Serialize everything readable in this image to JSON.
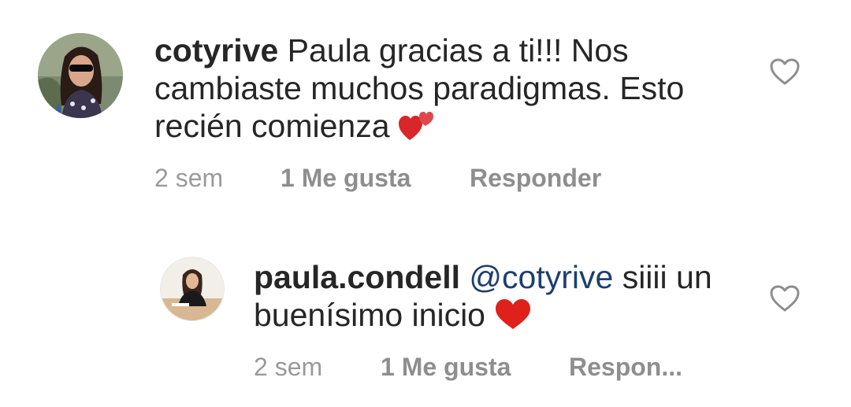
{
  "comments": [
    {
      "username": "cotyrive",
      "text_part1": "Paula gracias a ti!!! Nos cambiaste muchos paradigmas. Esto recién comienza",
      "emoji": "two-hearts",
      "time": "2 sem",
      "likes": "1 Me gusta",
      "reply": "Responder"
    },
    {
      "username": "paula.condell",
      "mention": "@cotyrive",
      "text_part1": "siiii un buenísimo inicio",
      "emoji": "red-heart",
      "time": "2 sem",
      "likes": "1 Me gusta",
      "reply": "Respon..."
    }
  ],
  "colors": {
    "text": "#262626",
    "meta": "#8e8e8e",
    "mention": "#1d3f6e",
    "heart_emoji": "#e0201b",
    "like_icon": "#8e8e8e"
  },
  "icons": {
    "like": "heart-outline-icon"
  }
}
